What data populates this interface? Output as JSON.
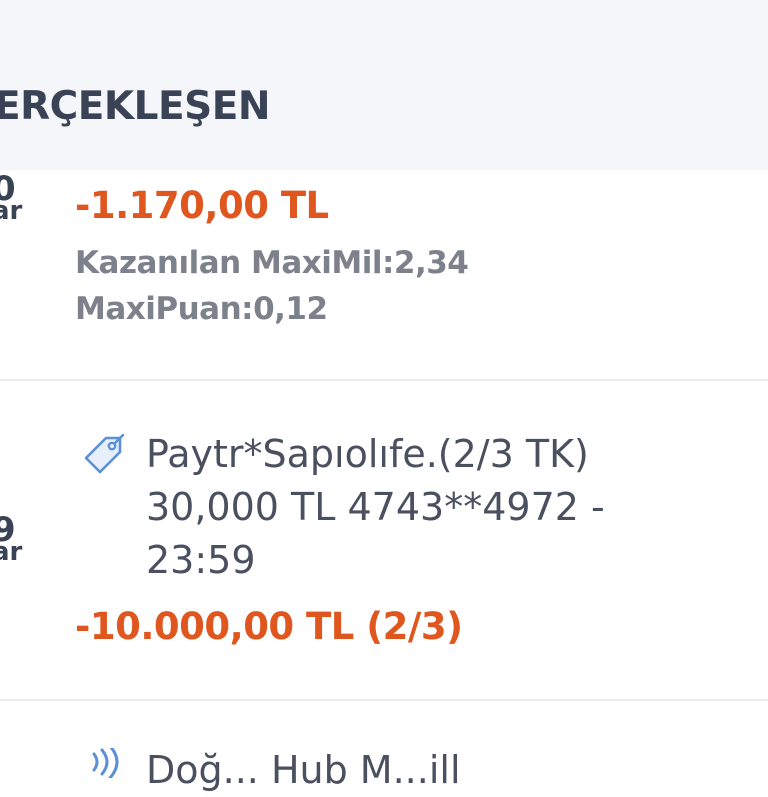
{
  "header": {
    "title": "ERÇEKLEŞEN"
  },
  "transactions": [
    {
      "day": "0",
      "month": "ar",
      "amount": "-1.170,00 TL",
      "maximil": "Kazanılan MaxiMil:2,34",
      "maxipuan": "MaxiPuan:0,12"
    },
    {
      "day": "9",
      "month": "ar",
      "description_lines": [
        "Paytr*Sapıolıfe.(2/3 TK)",
        "30,000 TL 4743**4972 -",
        "23:59"
      ],
      "amount": "-10.000,00 TL (2/3)",
      "icon": "tag-icon"
    },
    {
      "description_partial": "Doğ...   Hub M...ill",
      "icon": "wireless-payment-icon"
    }
  ],
  "colors": {
    "amount": "#e0561f",
    "header_bg": "#f5f6f9",
    "icon": "#5b8fd6"
  }
}
